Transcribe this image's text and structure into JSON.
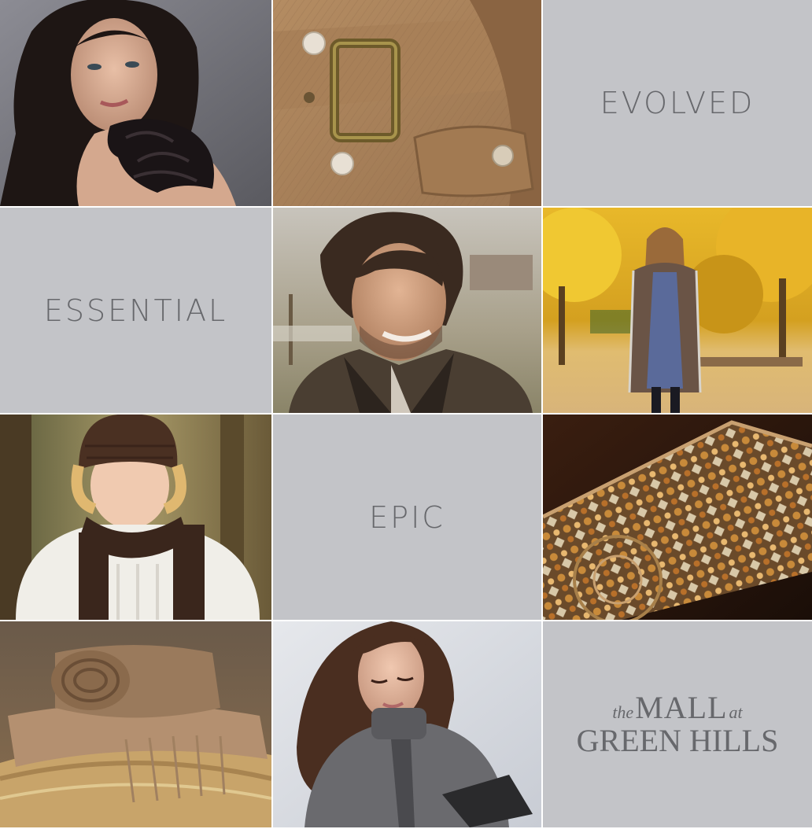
{
  "tiles": {
    "evolved": "EVOLVED",
    "essential": "ESSENTIAL",
    "epic": "EPIC"
  },
  "logo": {
    "the": "the",
    "mall": "MALL",
    "at": "at",
    "green_hills": "GREEN HILLS"
  },
  "colors": {
    "tile_gray": "#c3c4c8",
    "text_gray": "#67686c"
  },
  "photos": [
    "woman-dark-hair-ruffle-photo",
    "camel-coat-buckle-photo",
    "man-knit-sweater-photo",
    "woman-autumn-park-photo",
    "child-knit-hat-scarf-photo",
    "jeweled-clutch-photo",
    "folded-blankets-photo",
    "woman-gray-sweater-photo"
  ]
}
